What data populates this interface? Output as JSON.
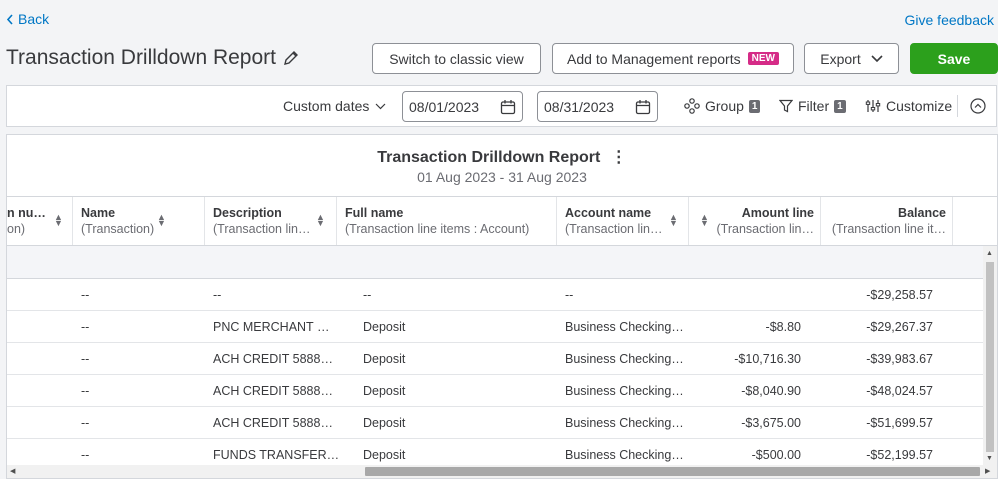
{
  "nav": {
    "back_label": "Back",
    "feedback_label": "Give feedback"
  },
  "header": {
    "title": "Transaction Drilldown Report",
    "switch_label": "Switch to classic view",
    "mgmt_label": "Add to Management reports",
    "new_badge": "NEW",
    "export_label": "Export",
    "save_label": "Save"
  },
  "toolbar": {
    "dates_label": "Custom dates",
    "start_date": "08/01/2023",
    "end_date": "08/31/2023",
    "group_label": "Group",
    "group_count": "1",
    "filter_label": "Filter",
    "filter_count": "1",
    "customize_label": "Customize"
  },
  "report": {
    "title": "Transaction Drilldown Report",
    "subtitle": "01 Aug 2023 - 31 Aug 2023",
    "columns": [
      {
        "l1": "n nu…",
        "l2": "on)"
      },
      {
        "l1": "Name",
        "l2": "(Transaction)"
      },
      {
        "l1": "Description",
        "l2": "(Transaction lin…"
      },
      {
        "l1": "Full name",
        "l2": "(Transaction line items : Account)"
      },
      {
        "l1": "Account name",
        "l2": "(Transaction lin…"
      },
      {
        "l1": "Amount line",
        "l2": "(Transaction lin…"
      },
      {
        "l1": "Balance",
        "l2": "(Transaction line it…"
      }
    ],
    "rows": [
      [
        "--",
        "--",
        "--",
        "--",
        "",
        "-$29,258.57"
      ],
      [
        "--",
        "PNC MERCHANT …",
        "Deposit",
        "Business Checking…",
        "-$8.80",
        "-$29,267.37"
      ],
      [
        "--",
        "ACH CREDIT 5888…",
        "Deposit",
        "Business Checking…",
        "-$10,716.30",
        "-$39,983.67"
      ],
      [
        "--",
        "ACH CREDIT 5888…",
        "Deposit",
        "Business Checking…",
        "-$8,040.90",
        "-$48,024.57"
      ],
      [
        "--",
        "ACH CREDIT 5888…",
        "Deposit",
        "Business Checking…",
        "-$3,675.00",
        "-$51,699.57"
      ],
      [
        "--",
        "FUNDS TRANSFER…",
        "Deposit",
        "Business Checking…",
        "-$500.00",
        "-$52,199.57"
      ]
    ]
  },
  "colors": {
    "link": "#0077c5",
    "save": "#2ca01c",
    "new_badge": "#d52b87"
  }
}
